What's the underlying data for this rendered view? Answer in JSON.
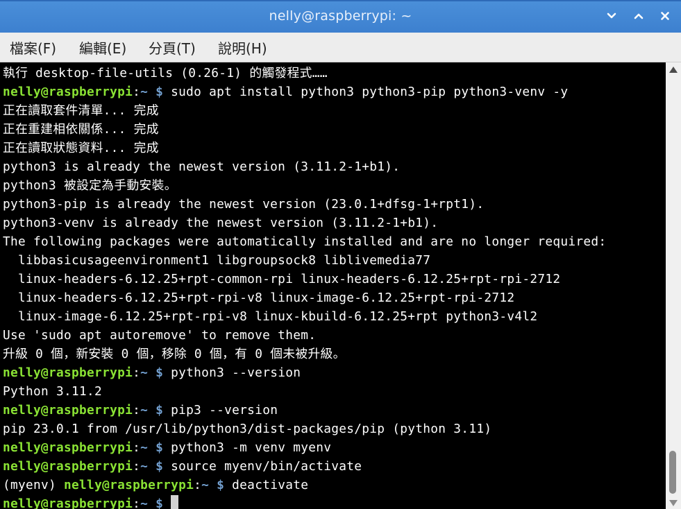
{
  "window": {
    "title": "nelly@raspberrypi: ~"
  },
  "menu": {
    "items": [
      "檔案(F)",
      "編輯(E)",
      "分頁(T)",
      "說明(H)"
    ]
  },
  "colors": {
    "prompt_user": "#8ae234",
    "prompt_path": "#729fcf",
    "text": "#ffffff",
    "titlebar": "#4287d6"
  },
  "terminal": {
    "lines": [
      {
        "text": "執行 desktop-file-utils (0.26-1) 的觸發程式……"
      },
      {
        "venv": "",
        "user": "nelly@raspberrypi",
        "colon": ":",
        "path": "~ $",
        "cmd": " sudo apt install python3 python3-pip python3-venv -y"
      },
      {
        "text": "正在讀取套件清單... 完成"
      },
      {
        "text": "正在重建相依關係... 完成"
      },
      {
        "text": "正在讀取狀態資料... 完成"
      },
      {
        "text": "python3 is already the newest version (3.11.2-1+b1)."
      },
      {
        "text": "python3 被設定為手動安裝。"
      },
      {
        "text": "python3-pip is already the newest version (23.0.1+dfsg-1+rpt1)."
      },
      {
        "text": "python3-venv is already the newest version (3.11.2-1+b1)."
      },
      {
        "text": "The following packages were automatically installed and are no longer required:"
      },
      {
        "text": "  libbasicusageenvironment1 libgroupsock8 liblivemedia77"
      },
      {
        "text": "  linux-headers-6.12.25+rpt-common-rpi linux-headers-6.12.25+rpt-rpi-2712"
      },
      {
        "text": "  linux-headers-6.12.25+rpt-rpi-v8 linux-image-6.12.25+rpt-rpi-2712"
      },
      {
        "text": "  linux-image-6.12.25+rpt-rpi-v8 linux-kbuild-6.12.25+rpt python3-v4l2"
      },
      {
        "text": "Use 'sudo apt autoremove' to remove them."
      },
      {
        "text": "升級 0 個，新安裝 0 個，移除 0 個，有 0 個未被升級。"
      },
      {
        "venv": "",
        "user": "nelly@raspberrypi",
        "colon": ":",
        "path": "~ $",
        "cmd": " python3 --version"
      },
      {
        "text": "Python 3.11.2"
      },
      {
        "venv": "",
        "user": "nelly@raspberrypi",
        "colon": ":",
        "path": "~ $",
        "cmd": " pip3 --version"
      },
      {
        "text": "pip 23.0.1 from /usr/lib/python3/dist-packages/pip (python 3.11)"
      },
      {
        "venv": "",
        "user": "nelly@raspberrypi",
        "colon": ":",
        "path": "~ $",
        "cmd": " python3 -m venv myenv"
      },
      {
        "venv": "",
        "user": "nelly@raspberrypi",
        "colon": ":",
        "path": "~ $",
        "cmd": " source myenv/bin/activate"
      },
      {
        "venv": "(myenv) ",
        "user": "nelly@raspberrypi",
        "colon": ":",
        "path": "~ $",
        "cmd": " deactivate"
      },
      {
        "venv": "",
        "user": "nelly@raspberrypi",
        "colon": ":",
        "path": "~ $",
        "cmd": " ",
        "cursor": true
      }
    ]
  }
}
